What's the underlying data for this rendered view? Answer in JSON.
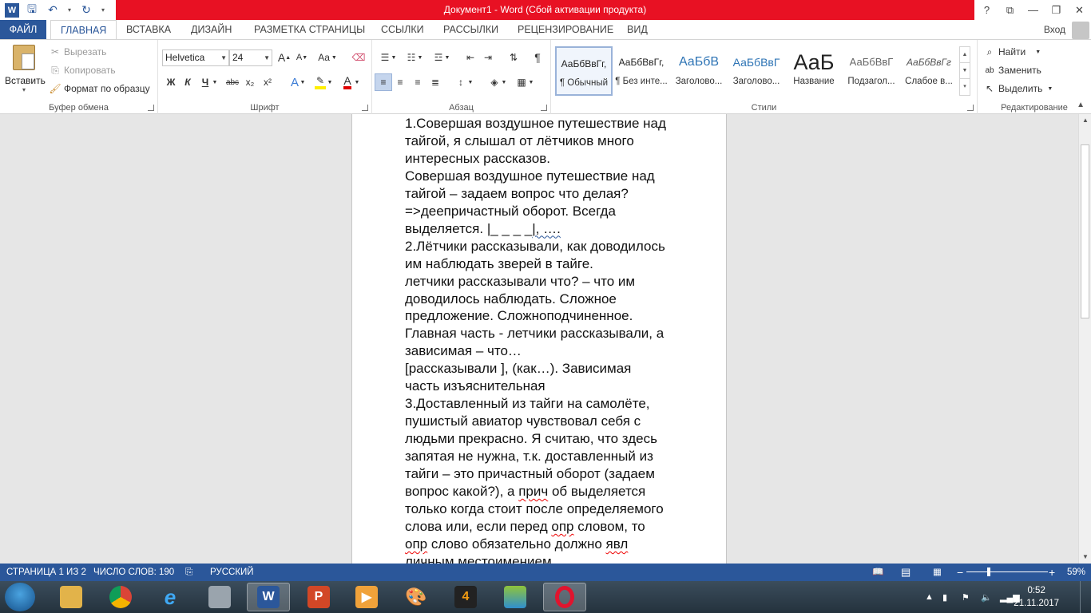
{
  "titlebar": {
    "title": "Документ1 -  Word (Сбой активации продукта)",
    "help": "?",
    "ribbon_options": "⧉",
    "minimize": "—",
    "restore": "❐",
    "close": "✕"
  },
  "tabs": {
    "file": "ФАЙЛ",
    "items": [
      "ГЛАВНАЯ",
      "ВСТАВКА",
      "ДИЗАЙН",
      "РАЗМЕТКА СТРАНИЦЫ",
      "ССЫЛКИ",
      "РАССЫЛКИ",
      "РЕЦЕНЗИРОВАНИЕ",
      "ВИД"
    ],
    "active": "ГЛАВНАЯ",
    "login": "Вход"
  },
  "clipboard": {
    "paste": "Вставить",
    "cut": "Вырезать",
    "copy": "Копировать",
    "format_painter": "Формат по образцу",
    "title": "Буфер обмена"
  },
  "font": {
    "name": "Helvetica",
    "size": "24",
    "title": "Шрифт",
    "bold": "Ж",
    "italic": "К",
    "underline": "Ч",
    "strike": "abc",
    "sub": "x₂",
    "sup": "x²",
    "grow": "A",
    "shrink": "A",
    "case": "Aa",
    "effects": "A",
    "color": "A"
  },
  "paragraph": {
    "title": "Абзац"
  },
  "styles": {
    "title": "Стили",
    "items": [
      {
        "preview": "АаБбВвГг,",
        "label": "¶ Обычный"
      },
      {
        "preview": "АаБбВвГг,",
        "label": "¶ Без инте..."
      },
      {
        "preview": "АаБбВ",
        "label": "Заголово..."
      },
      {
        "preview": "АаБбВвГ",
        "label": "Заголово..."
      },
      {
        "preview": "АаБ",
        "label": "Название"
      },
      {
        "preview": "АаБбВвГ",
        "label": "Подзагол..."
      },
      {
        "preview": "АаБбВвГг",
        "label": "Слабое в..."
      }
    ]
  },
  "editing": {
    "title": "Редактирование",
    "find": "Найти",
    "replace": "Заменить",
    "select": "Выделить"
  },
  "document": {
    "l01": "1.Совершая воздушное путешествие над",
    "l02": "тайгой, я слышал от лётчиков много",
    "l03": "интересных рассказов.",
    "l04": "Совершая воздушное путешествие над",
    "l05": "тайгой – задаем вопрос что делая?",
    "l06": "=>деепричастный оборот. Всегда",
    "l07a": "выделяется. |_ _ _ _",
    "l07b": "|, ….",
    "l08": "2.Лётчики рассказывали, как доводилось",
    "l09": "им наблюдать зверей в тайге.",
    "l10": "летчики рассказывали что? – что им",
    "l11": "доводилось наблюдать. Сложное",
    "l12": "предложение. Сложноподчиненное.",
    "l13": "Главная часть - летчики рассказывали, а",
    "l14": "зависимая – что…",
    "l15": "[рассказывали ], (как…). Зависимая",
    "l16": "часть изъяснительная",
    "l17": "3.Доставленный из тайги на самолёте,",
    "l18": "пушистый авиатор чувствовал себя с",
    "l19": "людьми прекрасно. Я считаю, что здесь",
    "l20": "запятая не нужна, т.к. доставленный из",
    "l21": "тайги – это причастный оборот (задаем",
    "l22a": "вопрос какой?), а ",
    "l22b": "прич",
    "l22c": " об выделяется",
    "l23": "только когда стоит после определяемого",
    "l24a": "слова или, если перед ",
    "l24b": "опр",
    "l24c": " словом, то",
    "l25a": "опр",
    "l25b": " слово обязательно должно ",
    "l25c": "явл",
    "l26": "личным местоимением."
  },
  "statusbar": {
    "page": "СТРАНИЦА 1 ИЗ 2",
    "words": "ЧИСЛО СЛОВ: 190",
    "language": "РУССКИЙ",
    "zoom": "59%",
    "zoom_fraction": 0.59
  },
  "taskbar": {
    "time": "0:52",
    "date": "21.11.2017"
  },
  "colors": {
    "word_blue": "#2b579a",
    "title_red": "#e81123"
  }
}
